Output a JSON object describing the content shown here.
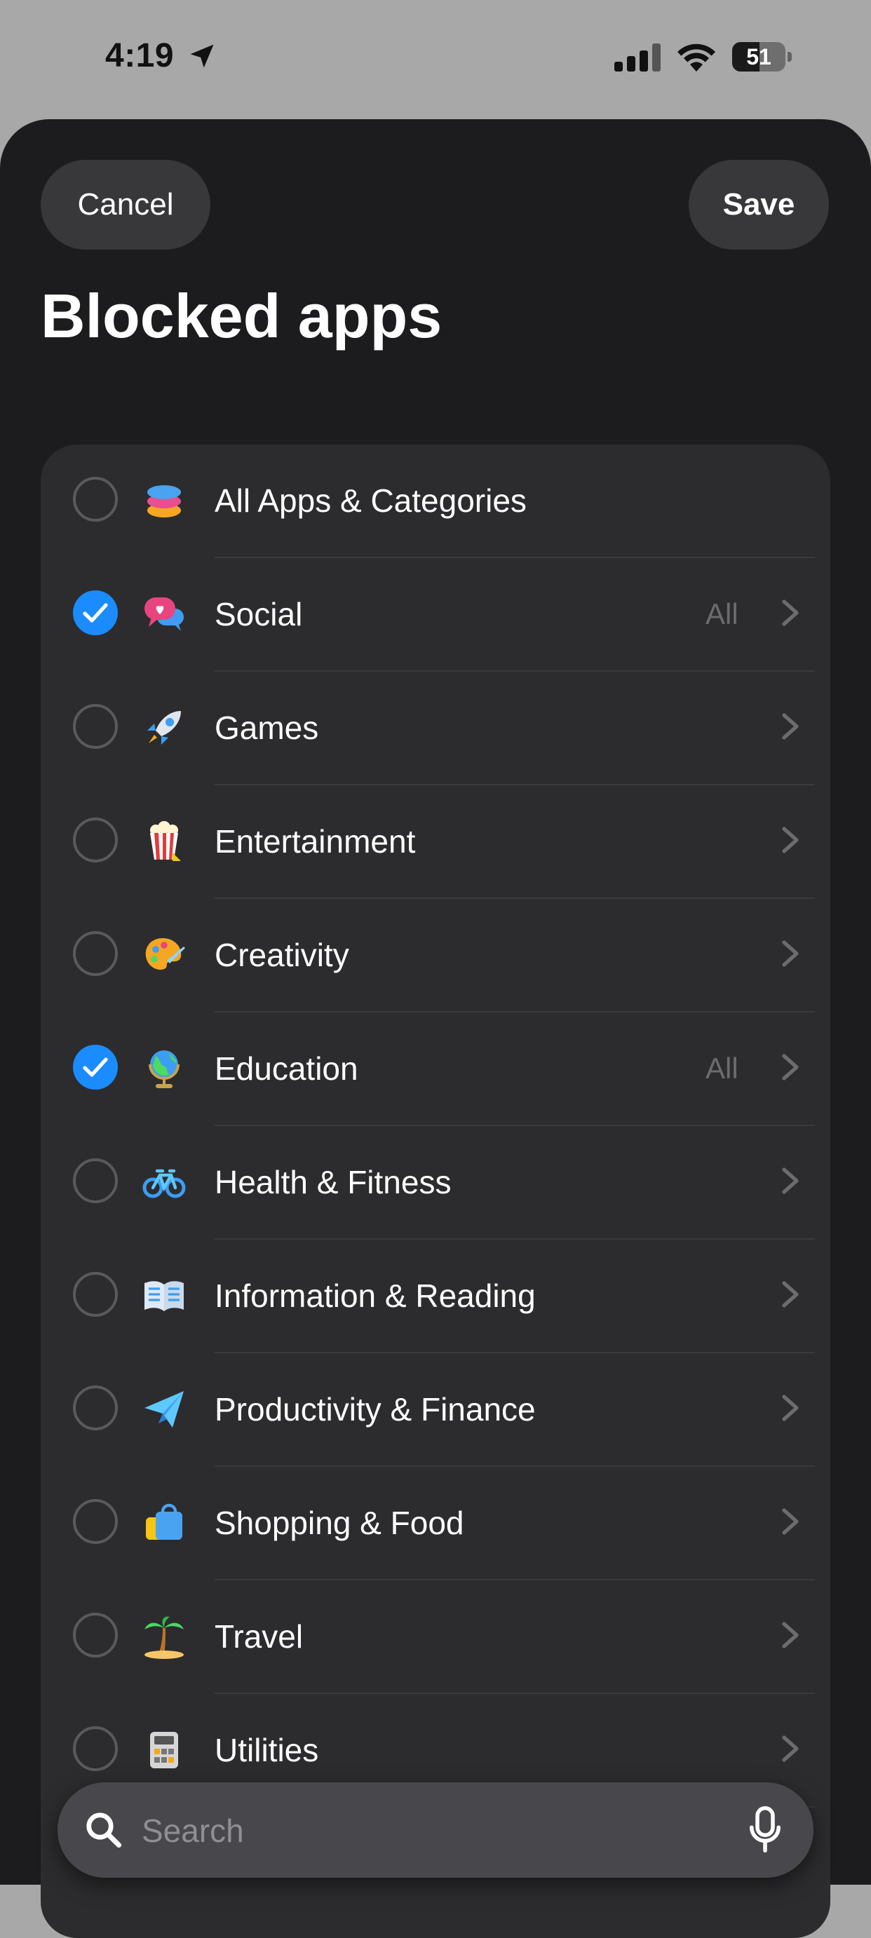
{
  "status_bar": {
    "time": "4:19",
    "battery_level": "51"
  },
  "header": {
    "cancel_label": "Cancel",
    "save_label": "Save",
    "title": "Blocked apps"
  },
  "colors": {
    "accent": "#1a8cff",
    "sheet_background": "#1c1c1e",
    "list_background": "#2c2c2e",
    "secondary_text": "#6c6c70"
  },
  "list": {
    "items": [
      {
        "label": "All Apps & Categories",
        "icon": "layers-stack-icon",
        "checked": false,
        "badge": "",
        "chevron": false
      },
      {
        "label": "Social",
        "icon": "speech-bubbles-icon",
        "checked": true,
        "badge": "All",
        "chevron": true
      },
      {
        "label": "Games",
        "icon": "rocket-icon",
        "checked": false,
        "badge": "",
        "chevron": true
      },
      {
        "label": "Entertainment",
        "icon": "popcorn-icon",
        "checked": false,
        "badge": "",
        "chevron": true
      },
      {
        "label": "Creativity",
        "icon": "paint-palette-icon",
        "checked": false,
        "badge": "",
        "chevron": true
      },
      {
        "label": "Education",
        "icon": "globe-icon",
        "checked": true,
        "badge": "All",
        "chevron": true
      },
      {
        "label": "Health & Fitness",
        "icon": "bicycle-icon",
        "checked": false,
        "badge": "",
        "chevron": true
      },
      {
        "label": "Information & Reading",
        "icon": "open-book-icon",
        "checked": false,
        "badge": "",
        "chevron": true
      },
      {
        "label": "Productivity & Finance",
        "icon": "paper-plane-icon",
        "checked": false,
        "badge": "",
        "chevron": true
      },
      {
        "label": "Shopping & Food",
        "icon": "shopping-bag-icon",
        "checked": false,
        "badge": "",
        "chevron": true
      },
      {
        "label": "Travel",
        "icon": "palm-tree-icon",
        "checked": false,
        "badge": "",
        "chevron": true
      },
      {
        "label": "Utilities",
        "icon": "calculator-icon",
        "checked": false,
        "badge": "",
        "chevron": true
      }
    ]
  },
  "search": {
    "placeholder": "Search",
    "value": ""
  }
}
